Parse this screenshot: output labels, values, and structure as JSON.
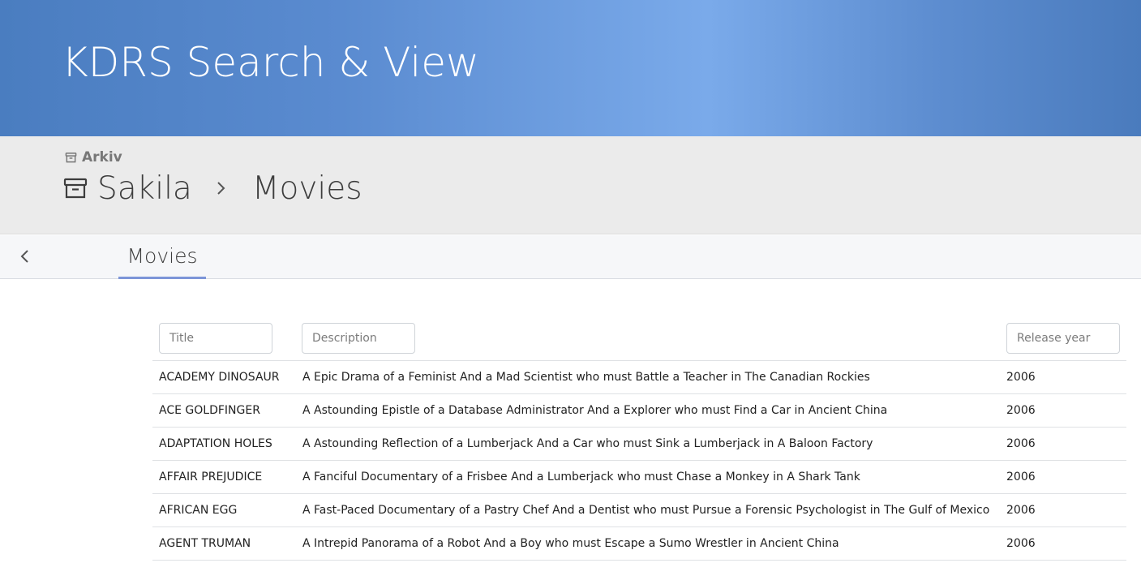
{
  "header": {
    "title": "KDRS Search & View"
  },
  "breadcrumb": {
    "context_label": "Arkiv",
    "archive": "Sakila",
    "current": "Movies"
  },
  "tabs": [
    {
      "label": "Movies",
      "active": true
    }
  ],
  "filters": {
    "title_placeholder": "Title",
    "description_placeholder": "Description",
    "release_year_placeholder": "Release year"
  },
  "table": {
    "rows": [
      {
        "title": "ACADEMY DINOSAUR",
        "description": "A Epic Drama of a Feminist And a Mad Scientist who must Battle a Teacher in The Canadian Rockies",
        "year": "2006"
      },
      {
        "title": "ACE GOLDFINGER",
        "description": "A Astounding Epistle of a Database Administrator And a Explorer who must Find a Car in Ancient China",
        "year": "2006"
      },
      {
        "title": "ADAPTATION HOLES",
        "description": "A Astounding Reflection of a Lumberjack And a Car who must Sink a Lumberjack in A Baloon Factory",
        "year": "2006"
      },
      {
        "title": "AFFAIR PREJUDICE",
        "description": "A Fanciful Documentary of a Frisbee And a Lumberjack who must Chase a Monkey in A Shark Tank",
        "year": "2006"
      },
      {
        "title": "AFRICAN EGG",
        "description": "A Fast-Paced Documentary of a Pastry Chef And a Dentist who must Pursue a Forensic Psychologist in The Gulf of Mexico",
        "year": "2006"
      },
      {
        "title": "AGENT TRUMAN",
        "description": "A Intrepid Panorama of a Robot And a Boy who must Escape a Sumo Wrestler in Ancient China",
        "year": "2006"
      }
    ]
  },
  "icons": {
    "archive": "archive-box-icon",
    "separator": "chevron-right-icon",
    "back": "chevron-left-icon"
  },
  "colors": {
    "header_gradient_start": "#4a7dc0",
    "header_gradient_mid": "#7aaaea",
    "breadcrumb_bg": "#ebebeb",
    "tab_underline": "#7c95d8"
  }
}
